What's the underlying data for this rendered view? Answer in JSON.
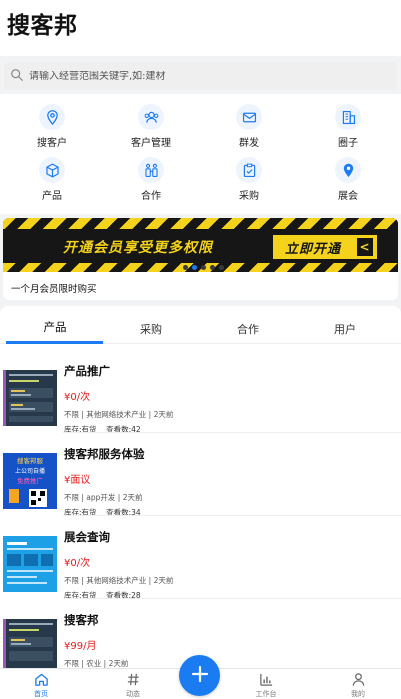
{
  "app": {
    "title": "搜客邦"
  },
  "search": {
    "placeholder": "请输入经营范围关键字,如:建材"
  },
  "grid": [
    {
      "label": "搜客户",
      "icon": "location-pin-outline-icon"
    },
    {
      "label": "客户管理",
      "icon": "users-icon"
    },
    {
      "label": "群发",
      "icon": "mail-icon"
    },
    {
      "label": "圈子",
      "icon": "building-icon"
    },
    {
      "label": "产品",
      "icon": "box-icon"
    },
    {
      "label": "合作",
      "icon": "partners-icon"
    },
    {
      "label": "采购",
      "icon": "clipboard-check-icon"
    },
    {
      "label": "展会",
      "icon": "location-pin-filled-icon"
    }
  ],
  "banner": {
    "text": "开通会员享受更多权限",
    "button": "立即开通",
    "arrow": "<",
    "caption": "一个月会员限时购买"
  },
  "tabs": [
    "产品",
    "采购",
    "合作",
    "用户"
  ],
  "products": [
    {
      "title": "产品推广",
      "price": "¥0/次",
      "meta": "不限 | 其他网络技术产业 | 2天前",
      "stock": "库存:有货",
      "views": "查看数:42"
    },
    {
      "title": "搜客邦服务体验",
      "price": "¥面议",
      "meta": "不限 | app开发 | 2天前",
      "stock": "库存:有货",
      "views": "查看数:34"
    },
    {
      "title": "展会查询",
      "price": "¥0/次",
      "meta": "不限 | 其他网络技术产业 | 2天前",
      "stock": "库存:有货",
      "views": "查看数:28"
    },
    {
      "title": "搜客邦",
      "price": "¥99/月",
      "meta": "不限 | 农业 | 2天前",
      "stock": "",
      "views": ""
    }
  ],
  "thumb2": {
    "line1": "搜客邦服",
    "line2": "上公司自播",
    "line3": "免费推广"
  },
  "tabbar": [
    {
      "label": "首页",
      "icon": "home-icon"
    },
    {
      "label": "动态",
      "icon": "hash-icon"
    },
    {
      "label": "工作台",
      "icon": "bar-chart-icon"
    },
    {
      "label": "我的",
      "icon": "user-icon"
    }
  ],
  "colors": {
    "accent": "#1a7cf0",
    "price": "#e61b1b",
    "banner_yellow": "#f5d21b"
  }
}
